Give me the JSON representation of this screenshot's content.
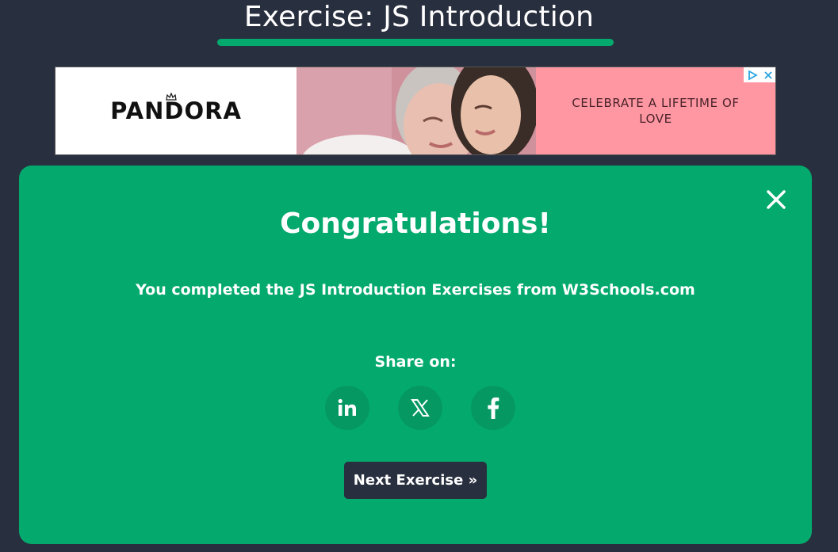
{
  "header": {
    "title": "Exercise: JS Introduction"
  },
  "ad": {
    "brand": "PANDORA",
    "slogan": "CELEBRATE A LIFETIME OF LOVE",
    "choices_icons": [
      "adchoices-icon",
      "close-icon"
    ]
  },
  "modal": {
    "heading": "Congratulations!",
    "message": "You completed the JS Introduction Exercises from W3Schools.com",
    "share_label": "Share on:",
    "share_buttons": [
      {
        "name": "linkedin-icon",
        "label": "in"
      },
      {
        "name": "x-icon",
        "label": "𝕏"
      },
      {
        "name": "facebook-icon",
        "label": "f"
      }
    ],
    "next_label": "Next Exercise »",
    "close_icon": "close-icon"
  },
  "colors": {
    "background": "#282f3f",
    "accent": "#04aa6d",
    "share_button": "#059862",
    "ad_pink": "#ff97a3"
  }
}
